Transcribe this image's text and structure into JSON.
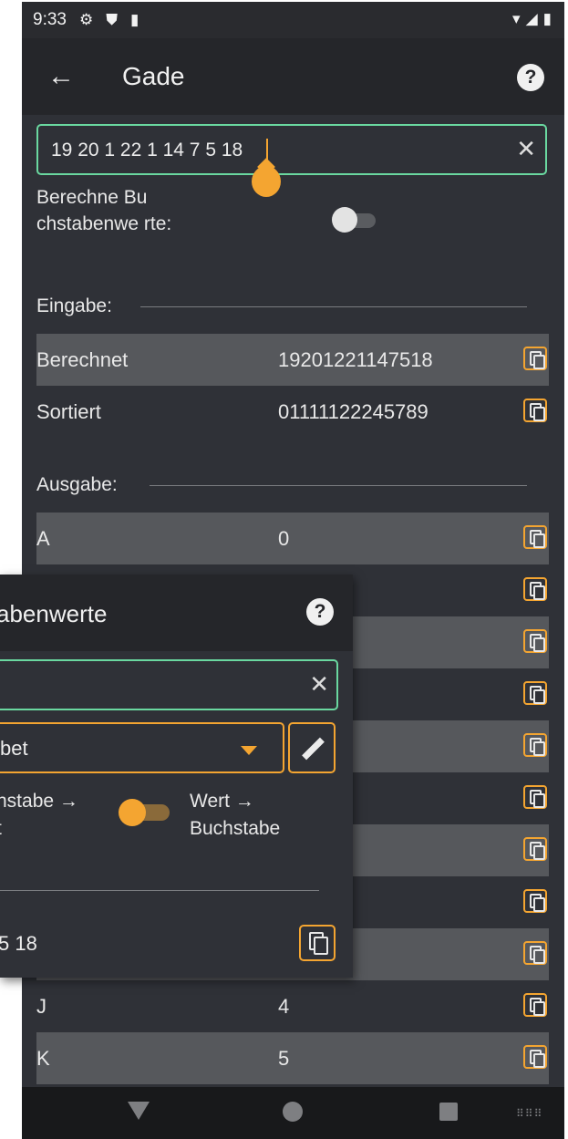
{
  "status_bar": {
    "time": "9:33",
    "icons": [
      "gear-icon",
      "shield-icon",
      "sd-card-icon",
      "wifi-icon",
      "signal-icon",
      "battery-icon"
    ]
  },
  "app_bar": {
    "title": "Gade",
    "back_icon": "arrow-left-icon",
    "help_icon": "help-circle-icon"
  },
  "input": {
    "value": "19 20 1 22 1 14 7 5 18",
    "clear_icon": "close-icon"
  },
  "calc_toggle": {
    "label": "Berechne Bu chstabenwe rte:",
    "on": false
  },
  "eingabe": {
    "heading": "Eingabe:",
    "rows": [
      {
        "key": "Berechnet",
        "value": "19201221147518"
      },
      {
        "key": "Sortiert",
        "value": "01111122245789"
      }
    ]
  },
  "ausgabe": {
    "heading": "Ausgabe:",
    "rows": [
      {
        "key": "A",
        "value": "0"
      },
      {
        "key": "J",
        "value": "4"
      },
      {
        "key": "K",
        "value": "5"
      }
    ]
  },
  "overlay": {
    "title": "abenwerte",
    "dropdown_value": "bet",
    "mode_left": "nstabe →\nt",
    "mode_right": "Wert →\nBuchstabe",
    "toggle_on": true,
    "result": "5 18"
  },
  "colors": {
    "accent": "#f4a531",
    "focus": "#6ad8a0",
    "background": "#2f3137",
    "row_shade": "#56585c"
  }
}
